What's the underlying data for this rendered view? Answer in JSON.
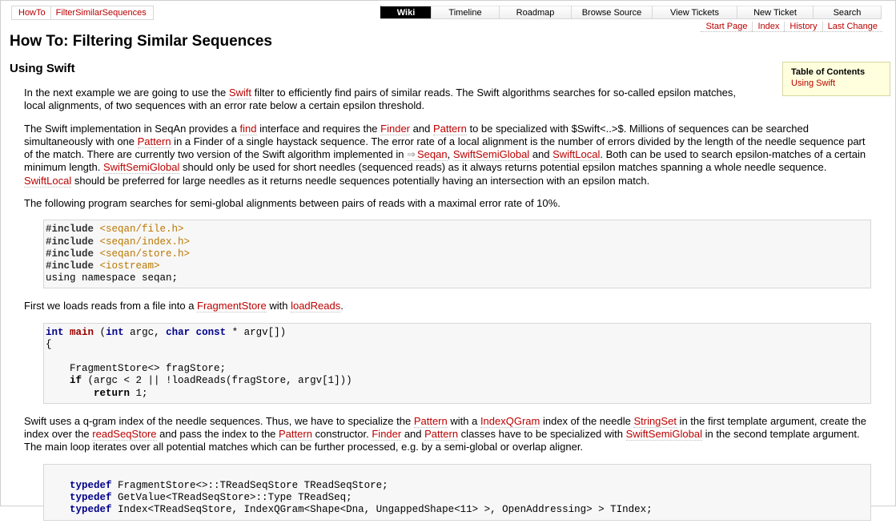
{
  "breadcrumb": [
    "HowTo",
    "FilterSimilarSequences"
  ],
  "mainnav": [
    "Wiki",
    "Timeline",
    "Roadmap",
    "Browse Source",
    "View Tickets",
    "New Ticket",
    "Search"
  ],
  "subnav": [
    "Start Page",
    "Index",
    "History",
    "Last Change"
  ],
  "page_title": "How To: Filtering Similar Sequences",
  "section_title": "Using Swift",
  "toc": {
    "title": "Table of Contents",
    "link": "Using Swift"
  },
  "p1": {
    "t0": "In the next example we are going to use the ",
    "l0": "Swift",
    "t1": " filter to efficiently find pairs of similar reads. The Swift algorithms searches for so-called epsilon matches, local alignments, of two sequences with an error rate below a certain epsilon threshold."
  },
  "p2": {
    "t0": "The Swift implementation in SeqAn provides a ",
    "l0": "find",
    "t1": " interface and requires the ",
    "l1": "Finder",
    "t2": " and ",
    "l2": "Pattern",
    "t3": " to be specialized with $Swift<..>$. Millions of sequences can be searched simultaneously with one ",
    "l3": "Pattern",
    "t4": " in a Finder of a single haystack sequence. The error rate of a local alignment is the number of errors divided by the length of the needle sequence part of the match. There are currently two version of the Swift algorithm implemented in ",
    "l4": "Seqan",
    "t5": ", ",
    "l5": "SwiftSemiGlobal",
    "t6": " and ",
    "l6": "SwiftLocal",
    "t7": ". Both can be used to search epsilon-matches of a certain minimum length. ",
    "l7": "SwiftSemiGlobal",
    "t8": " should only be used for short needles (sequenced reads) as it always returns potential epsilon matches spanning a whole needle sequence. ",
    "l8": "SwiftLocal",
    "t9": " should be preferred for large needles as it returns needle sequences potentially having an intersection with an epsilon match."
  },
  "p3": "The following program searches for semi-global alignments between pairs of reads with a maximal error rate of 10%.",
  "code1": {
    "inc": "#include",
    "h1": "<seqan/file.h>",
    "h2": "<seqan/index.h>",
    "h3": "<seqan/store.h>",
    "h4": "<iostream>",
    "last": "using namespace seqan;"
  },
  "p4": {
    "t0": "First we loads reads from a file into a ",
    "l0": "FragmentStore",
    "t1": " with ",
    "l1": "loadReads",
    "t2": "."
  },
  "code2": {
    "int": "int",
    "main": "main",
    "sig_a": " (",
    "sig_b": " argc, ",
    "char": "char",
    "const": "const",
    "sig_c": " * argv[])",
    "brace": "{",
    "decl": "    FragmentStore<> fragStore;",
    "if": "if",
    "cond": " (argc < 2 || !loadReads(fragStore, argv[1]))",
    "return": "return",
    "ret_val": " 1;"
  },
  "p5": {
    "t0": "Swift uses a q-gram index of the needle sequences. Thus, we have to specialize the ",
    "l0": "Pattern",
    "t1": " with a ",
    "l1": "IndexQGram",
    "t2": " index of the needle ",
    "l2": "StringSet",
    "t3": " in the first template argument, create the index over the ",
    "l3": "readSeqStore",
    "t4": " and pass the index to the ",
    "l4": "Pattern",
    "t5": " constructor. ",
    "l5": "Finder",
    "t6": " and ",
    "l6": "Pattern",
    "t7": " classes have to be specialized with ",
    "l7": "SwiftSemiGlobal",
    "t8": " in the second template argument. The main loop iterates over all potential matches which can be further processed, e.g. by a semi-global or overlap aligner."
  },
  "code3": {
    "typedef": "typedef",
    "l1": " FragmentStore<>::TReadSeqStore TReadSeqStore;",
    "l2": " GetValue<TReadSeqStore>::Type TReadSeq;",
    "l3": " Index<TReadSeqStore, IndexQGram<Shape<Dna, UngappedShape<11> >, OpenAddressing> > TIndex;"
  }
}
